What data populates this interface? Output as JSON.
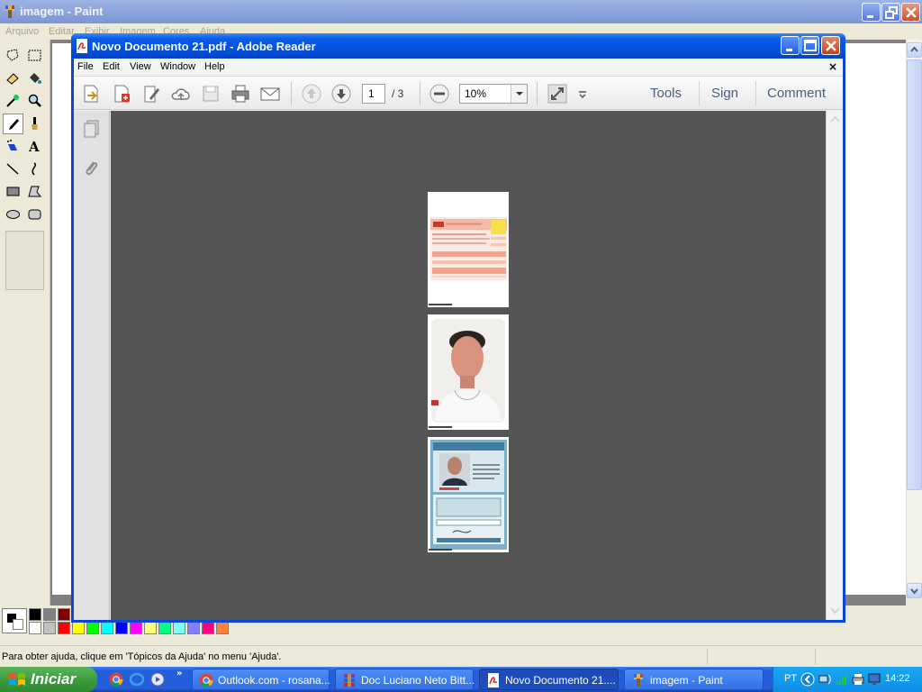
{
  "paint": {
    "title": "imagem - Paint",
    "menu": [
      "Arquivo",
      "Editar",
      "Exibir",
      "Imagem",
      "Cores",
      "Ajuda"
    ],
    "status_text": "Para obter ajuda, clique em 'Tópicos da Ajuda' no menu 'Ajuda'.",
    "palette_top": [
      "#000000",
      "#808080",
      "#800000",
      "#808000",
      "#008000",
      "#008080",
      "#000080",
      "#800080",
      "#808040",
      "#004040",
      "#0080ff",
      "#004080",
      "#4000ff",
      "#804000"
    ],
    "palette_bottom": [
      "#ffffff",
      "#c0c0c0",
      "#ff0000",
      "#ffff00",
      "#00ff00",
      "#00ffff",
      "#0000ff",
      "#ff00ff",
      "#ffff80",
      "#00ff80",
      "#80ffff",
      "#8080ff",
      "#ff0080",
      "#ff8040"
    ],
    "tools": [
      "free-select",
      "rect-select",
      "eraser",
      "fill",
      "color-picker",
      "magnifier",
      "pencil",
      "brush",
      "airbrush",
      "text",
      "line",
      "curve",
      "rectangle",
      "polygon",
      "ellipse",
      "rounded-rectangle"
    ],
    "active_tool": "pencil"
  },
  "reader": {
    "title": "Novo Documento 21.pdf - Adobe Reader",
    "menu": [
      "File",
      "Edit",
      "View",
      "Window",
      "Help"
    ],
    "menu_close": "×",
    "page_current": "1",
    "page_total": "/ 3",
    "zoom": "10%",
    "panels": [
      "Tools",
      "Sign",
      "Comment"
    ],
    "pages": [
      {
        "kind": "document-scan"
      },
      {
        "kind": "portrait-photo"
      },
      {
        "kind": "id-card-scan"
      }
    ]
  },
  "taskbar": {
    "start_label": "Iniciar",
    "tasks": [
      {
        "label": "Outlook.com - rosana...",
        "icon": "chrome-icon"
      },
      {
        "label": "Doc Luciano Neto Bitt...",
        "icon": "winrar-icon"
      },
      {
        "label": "Novo Documento 21....",
        "icon": "pdf-icon",
        "active": true
      },
      {
        "label": "imagem - Paint",
        "icon": "paint-icon"
      }
    ],
    "language": "PT",
    "clock": "14:22"
  }
}
